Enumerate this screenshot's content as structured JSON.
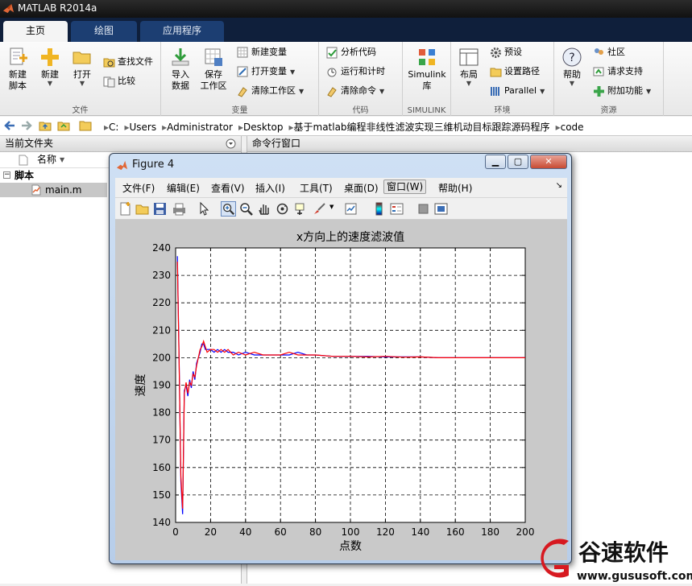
{
  "app": {
    "title": "MATLAB R2014a"
  },
  "tabs": [
    {
      "label": "主页"
    },
    {
      "label": "绘图"
    },
    {
      "label": "应用程序"
    }
  ],
  "ribbon": {
    "file": {
      "label": "文件",
      "new_script": "新建\n脚本",
      "new": "新建",
      "open": "打开",
      "find_files": "查找文件",
      "compare": "比较"
    },
    "variable": {
      "label": "变量",
      "import": "导入\n数据",
      "save_workspace": "保存\n工作区",
      "new_variable": "新建变量",
      "open_variable": "打开变量",
      "clear_workspace": "清除工作区"
    },
    "code": {
      "label": "代码",
      "analyze": "分析代码",
      "run_time": "运行和计时",
      "clear_commands": "清除命令"
    },
    "simulink": {
      "label": "SIMULINK",
      "simulink_lib": "Simulink\n库"
    },
    "environment": {
      "label": "环境",
      "layout": "布局",
      "preferences": "预设",
      "set_path": "设置路径",
      "parallel": "Parallel"
    },
    "resources": {
      "label": "资源",
      "help": "帮助",
      "community": "社区",
      "request_support": "请求支持",
      "addons": "附加功能"
    }
  },
  "address": {
    "crumbs": [
      "C:",
      "Users",
      "Administrator",
      "Desktop",
      "基于matlab编程非线性滤波实现三维机动目标跟踪源码程序",
      "code"
    ]
  },
  "current_folder": {
    "title": "当前文件夹",
    "column_name": "名称",
    "group": "脚本",
    "file": "main.m"
  },
  "command_window": {
    "title": "命令行窗口"
  },
  "figure": {
    "title": "Figure 4",
    "menu": [
      "文件(F)",
      "编辑(E)",
      "查看(V)",
      "插入(I)",
      "工具(T)",
      "桌面(D)",
      "窗口(W)",
      "帮助(H)"
    ],
    "active_menu": "窗口(W)",
    "toolbar_icons": [
      "new-figure-icon",
      "open-file-icon",
      "save-icon",
      "print-icon",
      "pointer-icon",
      "zoom-in-icon",
      "zoom-out-icon",
      "pan-icon",
      "rotate-3d-icon",
      "data-cursor-icon",
      "brush-icon",
      "link-plot-icon",
      "colorbar-icon",
      "legend-icon",
      "hide-plot-tools-icon",
      "show-plot-tools-icon"
    ]
  },
  "chart_data": {
    "type": "line",
    "title": "x方向上的速度滤波值",
    "xlabel": "点数",
    "ylabel": "速度",
    "xlim": [
      0,
      200
    ],
    "ylim": [
      140,
      240
    ],
    "xticks": [
      0,
      20,
      40,
      60,
      80,
      100,
      120,
      140,
      160,
      180,
      200
    ],
    "yticks": [
      140,
      150,
      160,
      170,
      180,
      190,
      200,
      210,
      220,
      230,
      240
    ],
    "grid": true,
    "series": [
      {
        "color": "#0000ff",
        "x": [
          1,
          2,
          3,
          4,
          5,
          6,
          7,
          8,
          9,
          10,
          11,
          12,
          13,
          14,
          15,
          16,
          17,
          18,
          20,
          22,
          24,
          26,
          28,
          30,
          33,
          36,
          40,
          45,
          50,
          55,
          60,
          65,
          70,
          75,
          80,
          90,
          100,
          110,
          120,
          130,
          140,
          150,
          160,
          170,
          180,
          190,
          200
        ],
        "y": [
          237,
          200,
          155,
          143,
          188,
          190,
          186,
          192,
          189,
          195,
          192,
          198,
          200,
          202,
          205,
          205,
          203,
          203,
          203,
          202,
          203,
          202,
          203,
          202,
          202,
          201,
          202,
          201,
          201,
          201,
          201,
          201,
          202,
          201,
          201,
          200.5,
          200.5,
          200.5,
          200.3,
          200.3,
          200.3,
          200,
          200,
          200,
          200,
          200,
          200
        ]
      },
      {
        "color": "#ff0000",
        "x": [
          1,
          2,
          3,
          4,
          5,
          6,
          7,
          8,
          9,
          10,
          11,
          12,
          13,
          14,
          15,
          16,
          17,
          18,
          20,
          22,
          24,
          26,
          28,
          30,
          33,
          36,
          40,
          45,
          50,
          55,
          60,
          65,
          70,
          75,
          80,
          90,
          100,
          110,
          120,
          130,
          140,
          150,
          160,
          170,
          180,
          190,
          200
        ],
        "y": [
          235,
          199,
          157,
          145,
          187,
          191,
          187,
          191,
          190,
          194,
          193,
          197,
          200,
          203,
          204,
          206,
          204,
          202,
          203,
          203,
          202,
          203,
          202,
          203,
          201,
          202,
          201,
          202,
          201,
          201,
          201,
          202,
          201,
          201,
          201,
          200.5,
          200.5,
          200.3,
          200.5,
          200.2,
          200.3,
          200,
          200,
          200,
          200,
          200,
          200
        ]
      }
    ]
  },
  "colors": {
    "ribbon_tab_bar": "#0f1f3b",
    "plot_line": "#0000ff",
    "plot_line2": "#ff0000"
  },
  "watermark": {
    "brand": "谷速软件",
    "url": "www.gususoft.com"
  }
}
